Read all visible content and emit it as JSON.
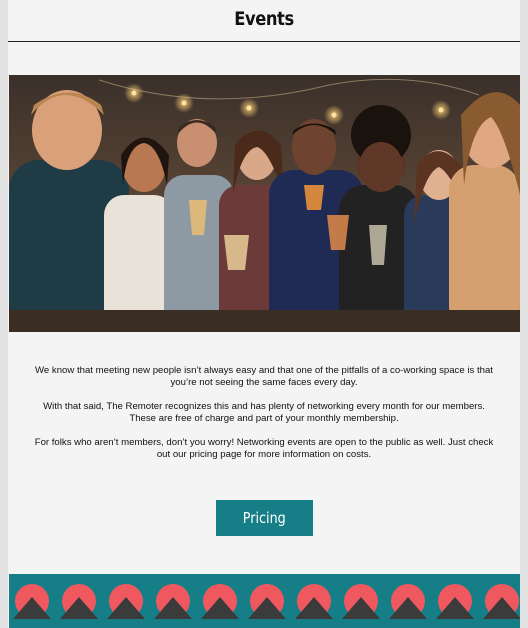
{
  "header": {
    "title": "Events"
  },
  "hero": {
    "icon": "group-party-photo"
  },
  "content": {
    "paragraphs": [
      "We know that meeting new people isn’t always easy and that one of the pitfalls of a co-working space is that you’re not seeing the same faces every day.",
      "With that said, The Remoter recognizes this and has plenty of networking every month for our members. These are free of charge and part of your monthly membership.",
      "For folks who aren’t members, don’t you worry! Networking events are open to the public as well. Just check out our pricing page for more information on costs."
    ]
  },
  "cta": {
    "pricing_label": "Pricing"
  },
  "colors": {
    "accent": "#167e87",
    "pattern_circle": "#f0585f",
    "pattern_triangle": "#3b3b3b",
    "page_background": "#f4f4f4"
  }
}
